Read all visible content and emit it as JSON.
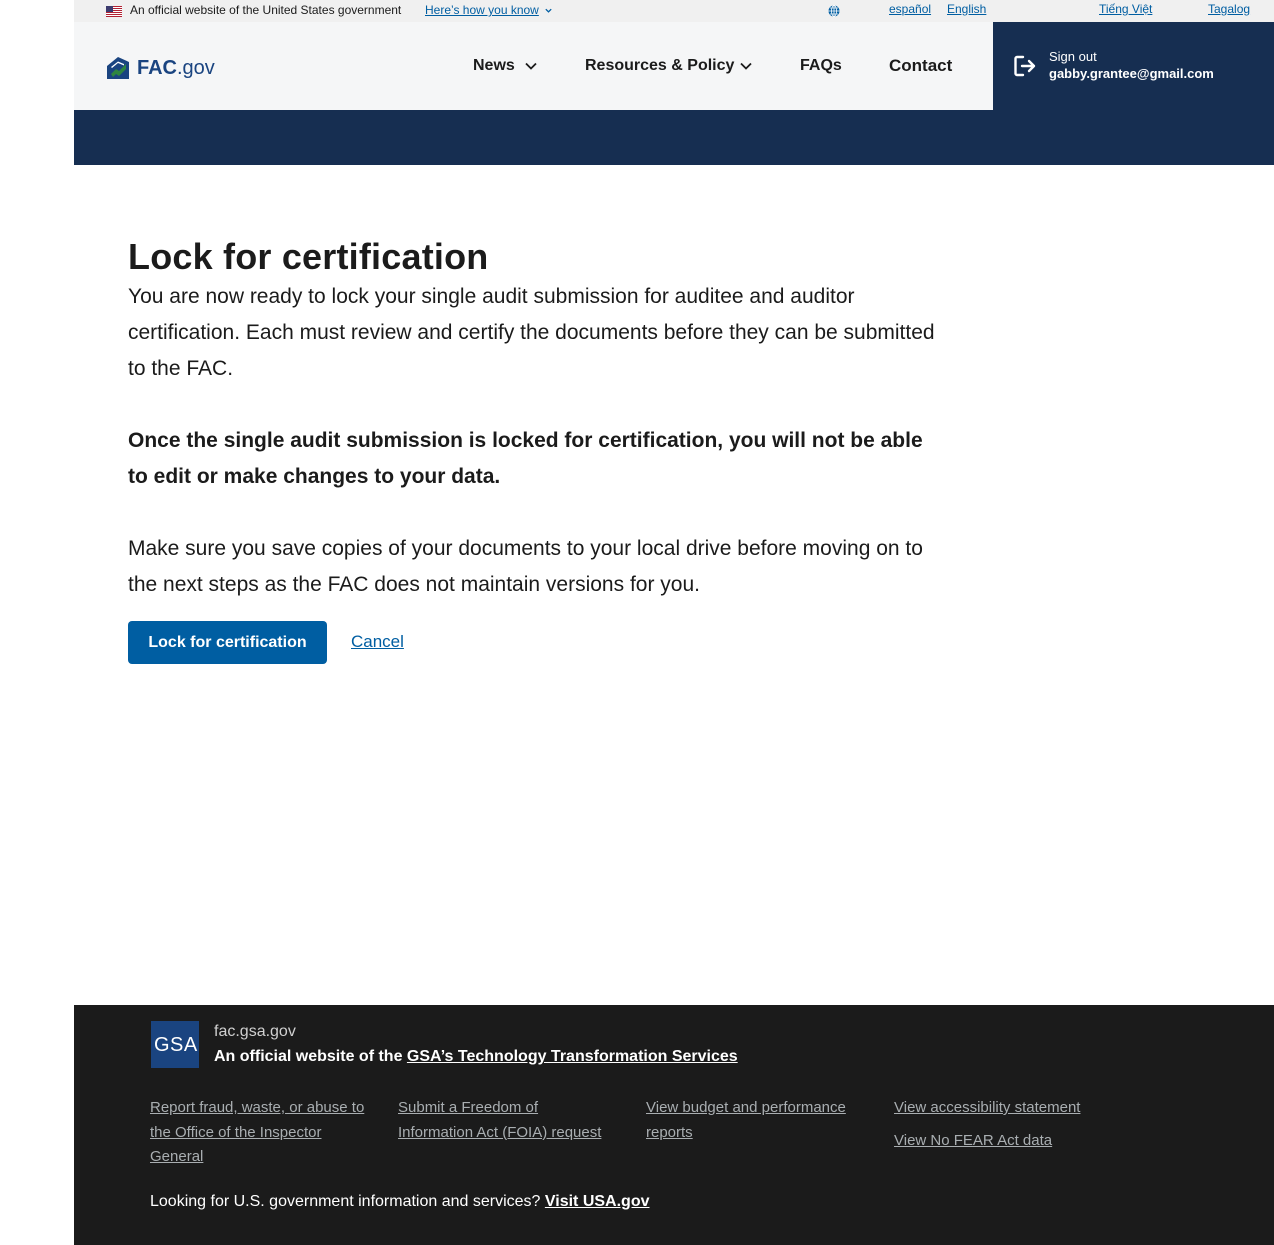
{
  "banner": {
    "official_text": "An official website of the United States government",
    "how_link": "Here’s how you know",
    "languages": [
      "español",
      "English",
      "Tiếng Việt",
      "Tagalog"
    ]
  },
  "header": {
    "logo_fac": "FAC",
    "logo_gov": ".gov",
    "nav": {
      "news": "News",
      "resources": "Resources & Policy",
      "faqs": "FAQs",
      "contact": "Contact"
    },
    "signout_label": "Sign out",
    "user_email": "gabby.grantee@gmail.com"
  },
  "main": {
    "title": "Lock for certification",
    "intro": "You are now ready to lock your single audit submission for auditee and auditor certification. Each must review and certify the documents before they can be submitted to the FAC.",
    "warning": "Once the single audit submission is locked for certification, you will not be able to edit or make changes to your data.",
    "reminder": "Make sure you save copies of your documents to your local drive before moving on to the next steps as the FAC does not maintain versions for you.",
    "lock_button": "Lock for certification",
    "cancel_link": "Cancel"
  },
  "footer": {
    "gsa_logo_text": "GSA",
    "domain": "fac.gsa.gov",
    "official_prefix": "An official website of the ",
    "official_link": "GSA’s Technology Transformation Services",
    "links": {
      "fraud": "Report fraud, waste, or abuse to the Office of the Inspector General",
      "foia": "Submit a Freedom of Information Act (FOIA) request",
      "budget": "View budget and performance reports",
      "accessibility": "View accessibility statement",
      "nofear": "View No FEAR Act data"
    },
    "usagov_prefix": "Looking for U.S. government information and services? ",
    "usagov_link": "Visit USA.gov"
  },
  "colors": {
    "primary": "#005ea2",
    "navy": "#162e51",
    "footer_bg": "#1b1b1b",
    "logo_green": "#2e8540"
  }
}
